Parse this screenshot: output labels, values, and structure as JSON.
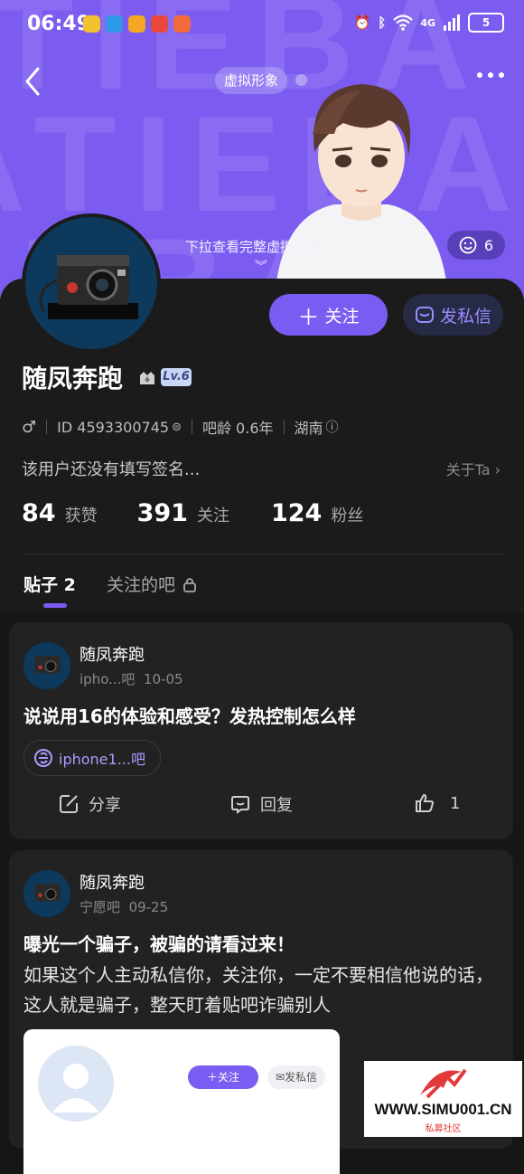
{
  "status": {
    "time": "06:49",
    "network": "4G",
    "battery": "5"
  },
  "header": {
    "virtual_label": "虚拟形象",
    "pull_tip": "下拉查看完整虚拟形象",
    "like_count": "6"
  },
  "profile": {
    "follow_label": "关注",
    "message_label": "发私信",
    "name": "随凤奔跑",
    "level": "Lv.6",
    "id_text": "ID 4593300745",
    "age": "吧龄 0.6年",
    "region": "湖南",
    "bio": "该用户还没有填写签名...",
    "about_label": "关于Ta"
  },
  "stats": {
    "likes": "84",
    "likes_label": "获赞",
    "following": "391",
    "following_label": "关注",
    "fans": "124",
    "fans_label": "粉丝"
  },
  "tabs": {
    "posts": "贴子 2",
    "followed_bars": "关注的吧"
  },
  "posts": [
    {
      "author": "随凤奔跑",
      "bar": "ipho...吧",
      "date": "10-05",
      "title": "说说用16的体验和感受？发热控制怎么样",
      "tag": "iphone1...吧",
      "share": "分享",
      "reply": "回复",
      "likes": "1"
    },
    {
      "author": "随凤奔跑",
      "bar": "宁愿吧",
      "date": "09-25",
      "title": "曝光一个骗子，被骗的请看过来！",
      "body": "如果这个人主动私信你，关注你，一定不要相信他说的话，这人就是骗子，整天盯着贴吧诈骗别人",
      "shot_follow": "关注",
      "shot_message": "发私信"
    }
  ],
  "watermark": {
    "site": "WWW.SIMU001.CN",
    "sub": "私募社区"
  }
}
